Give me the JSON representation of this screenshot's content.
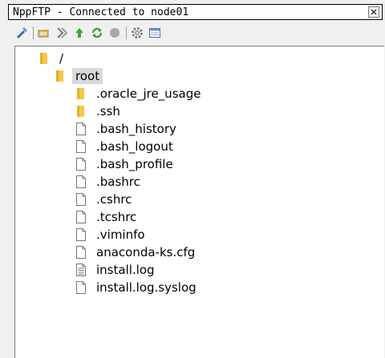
{
  "window": {
    "title": "NppFTP - Connected to node01"
  },
  "toolbar": {
    "items": [
      {
        "icon": "connect-icon"
      },
      {
        "icon": "folder-download-icon"
      },
      {
        "icon": "folder-upload-icon"
      },
      {
        "icon": "upload-arrow-icon"
      },
      {
        "icon": "refresh-icon"
      },
      {
        "icon": "abort-icon"
      },
      {
        "icon": "settings-gear-icon"
      },
      {
        "icon": "message-window-icon"
      }
    ]
  },
  "tree": {
    "nodes": [
      {
        "label": "/",
        "type": "folder",
        "depth": 0
      },
      {
        "label": "root",
        "type": "folder",
        "depth": 1,
        "selected": true
      },
      {
        "label": ".oracle_jre_usage",
        "type": "folder",
        "depth": 2
      },
      {
        "label": ".ssh",
        "type": "folder",
        "depth": 2
      },
      {
        "label": ".bash_history",
        "type": "file",
        "depth": 2
      },
      {
        "label": ".bash_logout",
        "type": "file",
        "depth": 2
      },
      {
        "label": ".bash_profile",
        "type": "file",
        "depth": 2
      },
      {
        "label": ".bashrc",
        "type": "file",
        "depth": 2
      },
      {
        "label": ".cshrc",
        "type": "file",
        "depth": 2
      },
      {
        "label": ".tcshrc",
        "type": "file",
        "depth": 2
      },
      {
        "label": ".viminfo",
        "type": "file",
        "depth": 2
      },
      {
        "label": "anaconda-ks.cfg",
        "type": "file",
        "depth": 2
      },
      {
        "label": "install.log",
        "type": "textfile",
        "depth": 2
      },
      {
        "label": "install.log.syslog",
        "type": "file",
        "depth": 2
      }
    ]
  },
  "colors": {
    "folder": "#f2c94c",
    "selection": "#d9d9d9"
  }
}
